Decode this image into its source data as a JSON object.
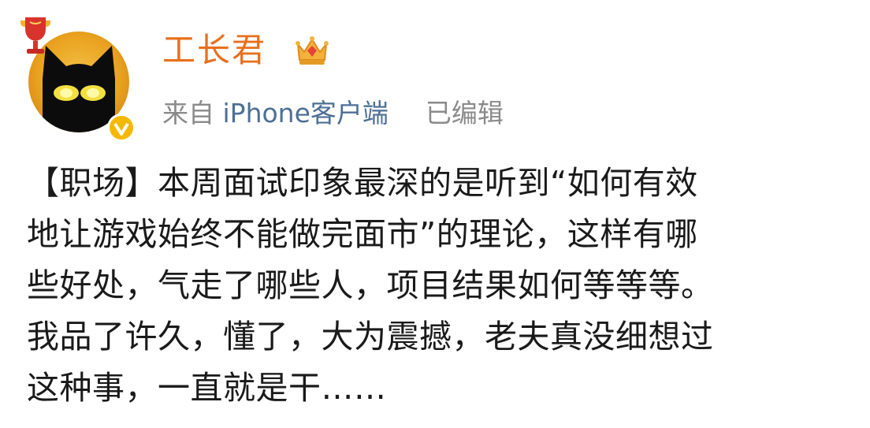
{
  "post": {
    "author": {
      "name": "工长君",
      "avatar_icon": "black-cat-avatar",
      "badge_icons": [
        "trophy-icon",
        "crown-icon",
        "verified-icon"
      ]
    },
    "meta": {
      "source_prefix": "来自",
      "source_client": "iPhone客户端",
      "edited_label": "已编辑"
    },
    "body_lines": [
      "【职场】本周面试印象最深的是听到“如何有效",
      "地让游戏始终不能做完面市”的理论，这样有哪",
      "些好处，气走了哪些人，项目结果如何等等等。",
      "我品了许久，懂了，大为震撼，老夫真没细想过",
      "这种事，一直就是干……"
    ]
  },
  "colors": {
    "username": "#e8701e",
    "meta_text": "#8a8a8a",
    "client_link": "#4e6f94",
    "body_text": "#1a1a1a",
    "verified_badge": "#f5b800"
  }
}
